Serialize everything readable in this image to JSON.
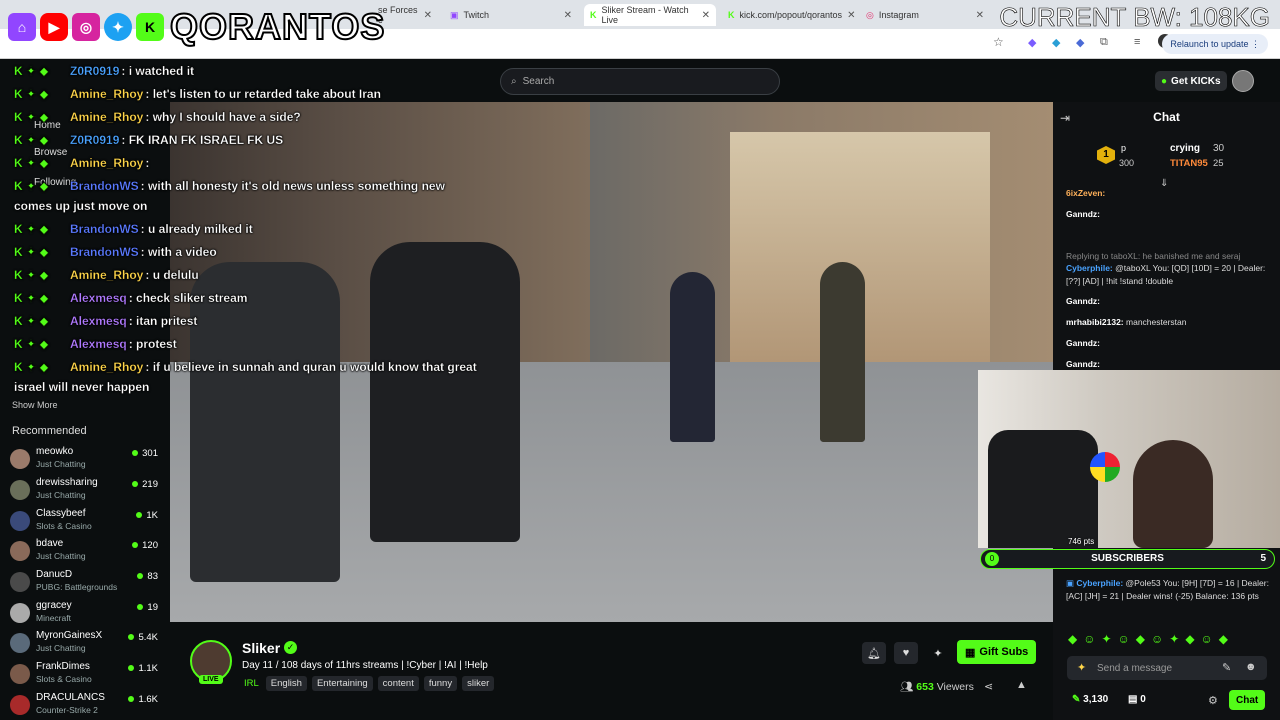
{
  "browser": {
    "tabs": [
      {
        "label": "se Forces c"
      },
      {
        "label": "Twitch"
      },
      {
        "label": "Sliker Stream - Watch Live"
      },
      {
        "label": "kick.com/popout/qorantos"
      },
      {
        "label": "Instagram"
      }
    ],
    "relaunch": "Relaunch to update"
  },
  "overlay": {
    "brand": "QORANTOS",
    "bw": "CURRENT BW: 108KG"
  },
  "header": {
    "search_placeholder": "Search",
    "get_kicks": "Get KICKs"
  },
  "sidebar": {
    "nav": [
      "Home",
      "Browse",
      "Following"
    ],
    "show_more": "Show More",
    "recommended_title": "Recommended",
    "recommended": [
      {
        "name": "meowko",
        "category": "Just Chatting",
        "viewers": "301",
        "color": "#9a7a6a"
      },
      {
        "name": "drewissharing",
        "category": "Just Chatting",
        "viewers": "219",
        "color": "#6a6f5a"
      },
      {
        "name": "Classybeef",
        "category": "Slots & Casino",
        "viewers": "1K",
        "color": "#3a4a7a"
      },
      {
        "name": "bdave",
        "category": "Just Chatting",
        "viewers": "120",
        "color": "#8a6a5a"
      },
      {
        "name": "DanucD",
        "category": "PUBG: Battlegrounds",
        "viewers": "83",
        "color": "#4a4a4a"
      },
      {
        "name": "ggracey",
        "category": "Minecraft",
        "viewers": "19",
        "color": "#aaaaaa"
      },
      {
        "name": "MyronGainesX",
        "category": "Just Chatting",
        "viewers": "5.4K",
        "color": "#5a6a7a"
      },
      {
        "name": "FrankDimes",
        "category": "Slots & Casino",
        "viewers": "1.1K",
        "color": "#7a5a4a"
      },
      {
        "name": "DRACULANCS",
        "category": "Counter-Strike 2",
        "viewers": "1.6K",
        "color": "#a82a2a"
      }
    ]
  },
  "overlay_chat": [
    {
      "user": "Z0R0919",
      "text": ": i watched it",
      "color": "#4aa3ff"
    },
    {
      "user": "Amine_Rhoy",
      "text": ": let's listen to ur retarded take about Iran",
      "color": "#ffd64a"
    },
    {
      "user": "Amine_Rhoy",
      "text": ": why I should have a side?",
      "color": "#ffd64a"
    },
    {
      "user": "Z0R0919",
      "text": ": FK IRAN FK ISRAEL FK US",
      "color": "#4aa3ff"
    },
    {
      "user": "Amine_Rhoy",
      "text": ":",
      "color": "#ffd64a"
    },
    {
      "user": "BrandonWS",
      "text": ": with all honesty it's old news unless something new",
      "color": "#5a7aff"
    },
    {
      "user": "",
      "text": "comes up just move on",
      "color": "#fff"
    },
    {
      "user": "BrandonWS",
      "text": ": u already milked it",
      "color": "#5a7aff"
    },
    {
      "user": "BrandonWS",
      "text": ": with a video",
      "color": "#5a7aff"
    },
    {
      "user": "Amine_Rhoy",
      "text": ": u delulu",
      "color": "#ffd64a"
    },
    {
      "user": "Alexmesq",
      "text": ": check sliker stream",
      "color": "#b07aff"
    },
    {
      "user": "Alexmesq",
      "text": ": itan pritest",
      "color": "#b07aff"
    },
    {
      "user": "Alexmesq",
      "text": ": protest",
      "color": "#b07aff"
    },
    {
      "user": "Amine_Rhoy",
      "text": ": if u believe in sunnah and quran u would know that great",
      "color": "#ffd64a"
    },
    {
      "user": "",
      "text": "israel will never happen",
      "color": "#fff"
    }
  ],
  "streamer": {
    "name": "Sliker",
    "live": "LIVE",
    "title": "Day 11 / 108 days of 11hrs streams | !Cyber | !AI | !Help",
    "category": "IRL",
    "tags": [
      "English",
      "Entertaining",
      "content",
      "funny",
      "sliker"
    ],
    "gift_subs": "Gift Subs",
    "viewers_count": "653",
    "viewers_label": "Viewers"
  },
  "chat": {
    "title": "Chat",
    "pinned_user": "p",
    "pinned_points": "300",
    "leaders": [
      {
        "name": "crying",
        "value": "30"
      },
      {
        "name": "TITAN95",
        "value": "25"
      }
    ],
    "messages": [
      {
        "user": "6ixZeven:",
        "text": "",
        "color": "#ffb15a"
      },
      {
        "user": "Ganndz:",
        "text": "",
        "color": "#fff"
      },
      {
        "user": "",
        "text": "Replying to taboXL: he banished me and seraj",
        "color": "#888"
      },
      {
        "user": "Cyberphile:",
        "text": "@taboXL You: [QD] [10D] = 20 | Dealer: [??] [AD] | !hit !stand !double",
        "color": "#4aa3ff"
      },
      {
        "user": "Ganndz:",
        "text": "",
        "color": "#fff"
      },
      {
        "user": "mrhabibi2132:",
        "text": "manchesterstan",
        "color": "#fff"
      },
      {
        "user": "Ganndz:",
        "text": "",
        "color": "#fff"
      },
      {
        "user": "Ganndz:",
        "text": "",
        "color": "#fff"
      }
    ],
    "cam_points": "746 pts",
    "subscribers_label": "SUBSCRIBERS",
    "subscribers_current": "0",
    "subscribers_goal": "5",
    "bottom_message": {
      "user": "Cyberphile:",
      "text": "@Pole53 You: [9H] [7D] = 16 | Dealer: [AC] [JH] = 21 | Dealer wins! (-25) Balance: 136 pts"
    },
    "placeholder": "Send a message",
    "points": "3,130",
    "zero": "0",
    "chat_button": "Chat"
  },
  "colors": {
    "accent": "#53fc18",
    "bg": "#0b0e0f"
  }
}
